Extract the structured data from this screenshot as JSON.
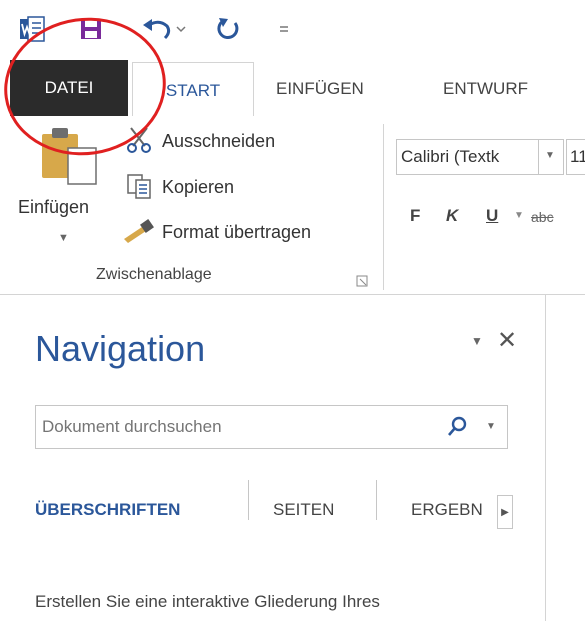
{
  "colors": {
    "accent": "#2b579a",
    "file_tab_bg": "#2b2b2b",
    "annotation": "#e02020"
  },
  "quick_access": {
    "icons": [
      "word-icon",
      "save-icon",
      "undo-icon",
      "redo-icon",
      "customize-icon"
    ]
  },
  "ribbon_tabs": {
    "file": "DATEI",
    "start": "START",
    "insert": "EINFÜGEN",
    "design": "ENTWURF"
  },
  "clipboard": {
    "paste": "Einfügen",
    "cut": "Ausschneiden",
    "copy": "Kopieren",
    "format_painter": "Format übertragen",
    "group_label": "Zwischenablage"
  },
  "font_group": {
    "font_name": "Calibri (Textk",
    "font_size": "11",
    "bold": "F",
    "italic": "K",
    "underline": "U",
    "strikethrough": "abc"
  },
  "navigation": {
    "title": "Navigation",
    "search_placeholder": "Dokument durchsuchen",
    "tabs": [
      "ÜBERSCHRIFTEN",
      "SEITEN",
      "ERGEBN"
    ],
    "hint": "Erstellen Sie eine interaktive Gliederung Ihres"
  }
}
